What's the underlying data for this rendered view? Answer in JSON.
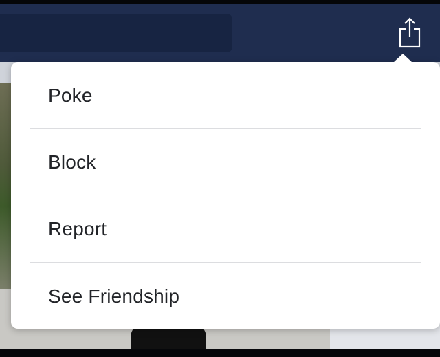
{
  "navbar": {
    "share_icon": "share-icon"
  },
  "menu": {
    "items": [
      {
        "label": "Poke"
      },
      {
        "label": "Block"
      },
      {
        "label": "Report"
      },
      {
        "label": "See Friendship"
      }
    ]
  },
  "colors": {
    "navbar": "#1f2d4f",
    "search_field": "#172442",
    "popover_bg": "#ffffff",
    "menu_text": "#222428"
  }
}
